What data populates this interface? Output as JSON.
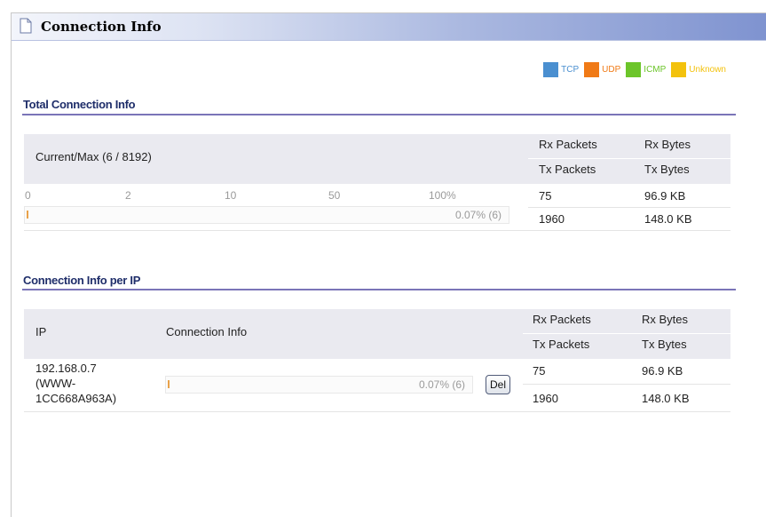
{
  "window": {
    "title": "Connection Info"
  },
  "legend": [
    {
      "label": "TCP",
      "color": "#4a8fd0",
      "text_color": "#4a8fd0"
    },
    {
      "label": "UDP",
      "color": "#f07a16",
      "text_color": "#f07a16"
    },
    {
      "label": "ICMP",
      "color": "#6cc52a",
      "text_color": "#6cc52a"
    },
    {
      "label": "Unknown",
      "color": "#f3c20d",
      "text_color": "#f3c20d"
    }
  ],
  "total": {
    "section_title": "Total Connection Info",
    "current_max_label": "Current/Max (6 / 8192)",
    "headers": {
      "rx_packets": "Rx Packets",
      "rx_bytes": "Rx Bytes",
      "tx_packets": "Tx Packets",
      "tx_bytes": "Tx Bytes"
    },
    "scale": [
      "0",
      "2",
      "10",
      "50",
      "100%"
    ],
    "usage_fraction": 0.0007,
    "usage_text": "0.07% (6)",
    "rx_packets": "75",
    "rx_bytes": "96.9 KB",
    "tx_packets": "1960",
    "tx_bytes": "148.0 KB"
  },
  "per_ip": {
    "section_title": "Connection Info per IP",
    "headers": {
      "ip": "IP",
      "connection_info": "Connection Info",
      "rx_packets": "Rx Packets",
      "rx_bytes": "Rx Bytes",
      "tx_packets": "Tx Packets",
      "tx_bytes": "Tx Bytes"
    },
    "rows": [
      {
        "ip_line1": "192.168.0.7",
        "ip_line2": "(WWW-",
        "ip_line3": "1CC668A963A)",
        "usage_fraction": 0.0007,
        "usage_text": "0.07% (6)",
        "del_label": "Del",
        "rx_packets": "75",
        "rx_bytes": "96.9 KB",
        "tx_packets": "1960",
        "tx_bytes": "148.0 KB"
      }
    ]
  }
}
